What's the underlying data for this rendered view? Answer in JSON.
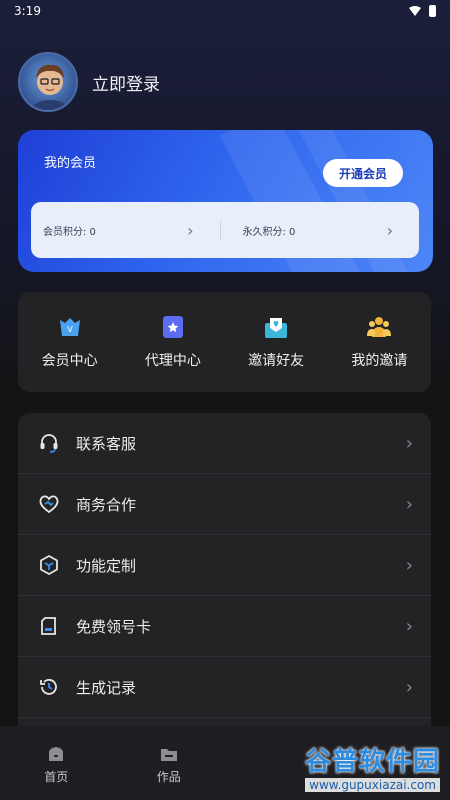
{
  "status": {
    "time": "3:19"
  },
  "profile": {
    "login_label": "立即登录"
  },
  "member": {
    "title": "我的会员",
    "open_button": "开通会员",
    "member_points_label": "会员积分: 0",
    "permanent_points_label": "永久积分: 0"
  },
  "quick_actions": [
    {
      "label": "会员中心",
      "icon": "crown-badge-icon",
      "color": "#4aa3f0"
    },
    {
      "label": "代理中心",
      "icon": "star-card-icon",
      "color": "#5c6cf0"
    },
    {
      "label": "邀请好友",
      "icon": "heart-envelope-icon",
      "color": "#3cb6d8"
    },
    {
      "label": "我的邀请",
      "icon": "people-icon",
      "color": "#f0b43a"
    }
  ],
  "menu": [
    {
      "label": "联系客服",
      "icon": "headset-icon"
    },
    {
      "label": "商务合作",
      "icon": "handshake-heart-icon"
    },
    {
      "label": "功能定制",
      "icon": "cube-icon"
    },
    {
      "label": "免费领号卡",
      "icon": "sim-card-icon"
    },
    {
      "label": "生成记录",
      "icon": "history-icon"
    }
  ],
  "tabs": [
    {
      "label": "首页",
      "icon": "home-icon"
    },
    {
      "label": "作品",
      "icon": "folder-icon"
    }
  ],
  "watermark": {
    "brand": "谷普软件园",
    "url": "www.gupuxiazai.com"
  }
}
